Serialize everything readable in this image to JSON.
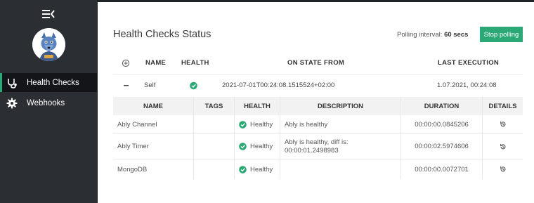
{
  "sidebar": {
    "items": [
      {
        "label": "Health Checks",
        "icon": "stethoscope-icon"
      },
      {
        "label": "Webhooks",
        "icon": "gear-icon"
      }
    ]
  },
  "header": {
    "title": "Health Checks Status",
    "polling_label": "Polling interval:",
    "polling_value": "60 secs",
    "stop_button": "Stop polling"
  },
  "table": {
    "columns": [
      "NAME",
      "HEALTH",
      "ON STATE FROM",
      "LAST EXECUTION"
    ],
    "rows": [
      {
        "name": "Self",
        "health": "healthy",
        "on_state_from": "2021-07-01T00:24:08.1515524+02:00",
        "last_execution": "1.07.2021, 00:24:08"
      }
    ]
  },
  "details": {
    "columns": [
      "NAME",
      "TAGS",
      "HEALTH",
      "DESCRIPTION",
      "DURATION",
      "DETAILS"
    ],
    "rows": [
      {
        "name": "Ably Channel",
        "tags": "",
        "health": "Healthy",
        "description": "Ably is healthy",
        "duration": "00:00:00.0845206"
      },
      {
        "name": "Ably Timer",
        "tags": "",
        "health": "Healthy",
        "description": "Ably is healthy, diff is: 00:00:01.2498983",
        "duration": "00:00:02.5974606"
      },
      {
        "name": "MongoDB",
        "tags": "",
        "health": "Healthy",
        "description": "",
        "duration": "00:00:00.0072701"
      }
    ]
  },
  "colors": {
    "accent": "#2aa876",
    "sidebar": "#2b2e33"
  }
}
